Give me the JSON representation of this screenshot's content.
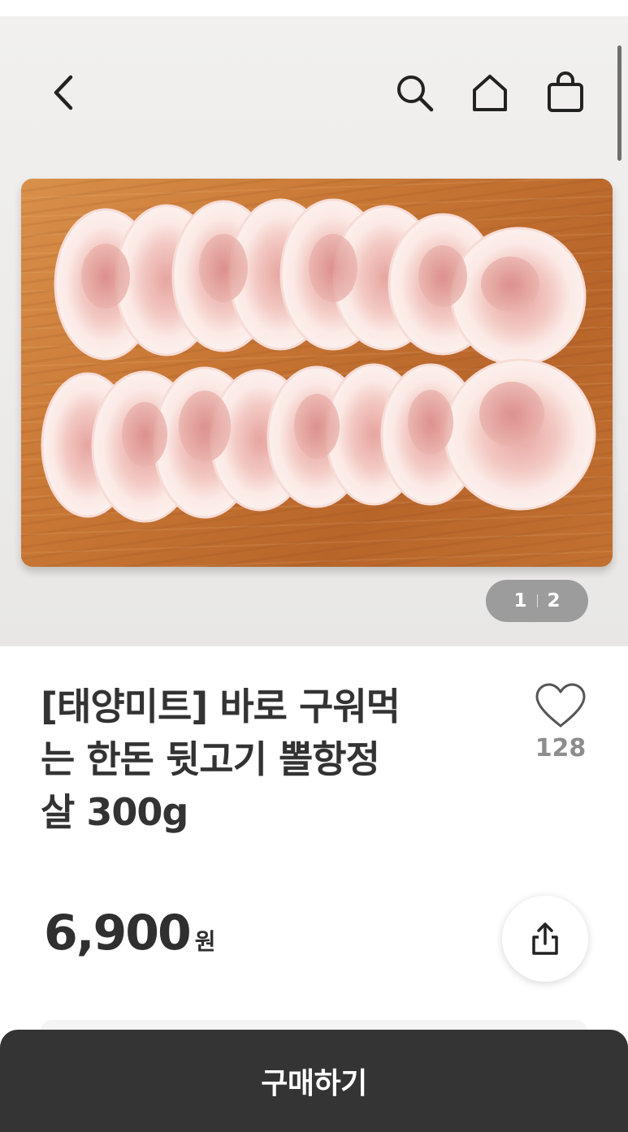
{
  "header": {
    "back_icon": "chevron-left-icon",
    "search_icon": "search-icon",
    "home_icon": "home-icon",
    "bag_icon": "shopping-bag-icon"
  },
  "gallery": {
    "current_page": "1",
    "total_pages": "2"
  },
  "product": {
    "title_line1": "[태양미트] 바로 구워먹",
    "title_line2": "는 한돈 뒷고기 뽈항정",
    "title_line3": "살 300g",
    "price": "6,900",
    "price_unit": "원",
    "like_count": "128"
  },
  "actions": {
    "buy_label": "구매하기",
    "share_icon": "share-icon",
    "like_icon": "heart-icon"
  },
  "colors": {
    "buy_button_bg": "#343434",
    "text_primary": "#333333",
    "like_count": "#8d8d8d"
  }
}
